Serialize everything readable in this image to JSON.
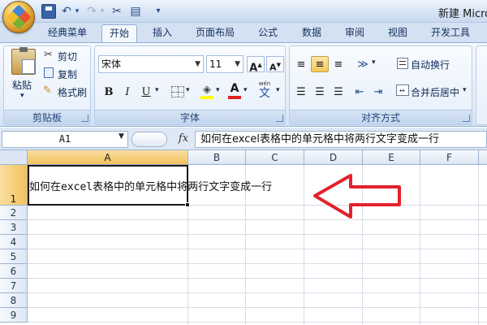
{
  "window": {
    "title": "新建 Micro"
  },
  "ribbon": {
    "tabs": [
      "经典菜单",
      "开始",
      "插入",
      "页面布局",
      "公式",
      "数据",
      "审阅",
      "视图",
      "开发工具"
    ],
    "active_tab": "开始",
    "clipboard": {
      "paste": "粘贴",
      "cut": "剪切",
      "copy": "复制",
      "format_painter": "格式刷",
      "label": "剪贴板"
    },
    "font": {
      "name": "宋体",
      "size": "11",
      "grow": "A",
      "shrink": "A",
      "bold": "B",
      "italic": "I",
      "underline": "U",
      "font_color_letter": "A",
      "phonetic_top": "wén",
      "phonetic": "文",
      "label": "字体"
    },
    "alignment": {
      "wrap": "自动换行",
      "merge": "合并后居中",
      "label": "对齐方式"
    }
  },
  "formula_bar": {
    "name_box": "A1",
    "fx": "fx",
    "content": "如何在excel表格中的单元格中将两行文字变成一行"
  },
  "sheet": {
    "columns": [
      "A",
      "B",
      "C",
      "D",
      "E",
      "F"
    ],
    "rows": [
      "1",
      "2",
      "3",
      "4",
      "5",
      "6",
      "7",
      "8",
      "9"
    ],
    "selected_cell": "A1",
    "cell_a1": "如何在excel表格中的单元格中将两行文字变成一行"
  },
  "colors": {
    "annotation_arrow": "#e3222c",
    "selection": "#f2c15d"
  }
}
